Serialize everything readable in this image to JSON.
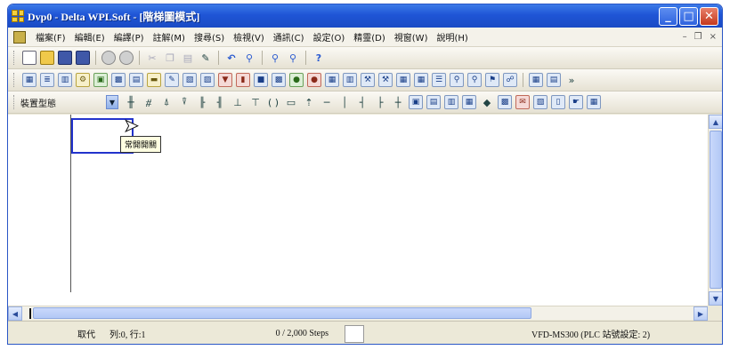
{
  "window": {
    "title": "Dvp0 - Delta WPLSoft - [階梯圖模式]",
    "minimize": "_",
    "maximize": "□",
    "close": "✕"
  },
  "menubar": {
    "items": [
      "檔案(F)",
      "編輯(E)",
      "編譯(P)",
      "註解(M)",
      "搜尋(S)",
      "檢視(V)",
      "通訊(C)",
      "設定(O)",
      "精靈(D)",
      "視窗(W)",
      "說明(H)"
    ],
    "restore": "- ",
    "mdi_restore": "ð",
    "mdi_close": "×"
  },
  "toolbar3": {
    "overflow": "»"
  },
  "toolbar4": {
    "dropdown_label": "裝置型態"
  },
  "ladder": {
    "tooltip": "常開開關"
  },
  "statusbar": {
    "mode": "取代",
    "position": "列:0, 行:1",
    "steps": "0 / 2,000 Steps",
    "plc": "VFD-MS300 (PLC 站號設定: 2)"
  },
  "icons": {
    "save": "disk-icon",
    "open": "folder-icon",
    "new": "new-document-icon"
  }
}
